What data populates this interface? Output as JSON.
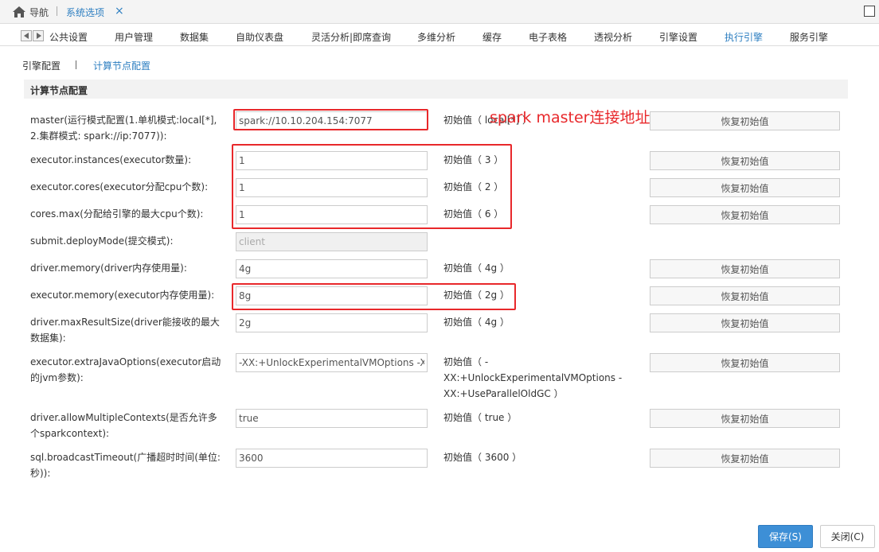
{
  "topbar": {
    "home_label": "导航",
    "active_tab": "系统选项",
    "close_glyph": "×"
  },
  "category_tabs": [
    {
      "label": "公共设置"
    },
    {
      "label": "用户管理"
    },
    {
      "label": "数据集"
    },
    {
      "label": "自助仪表盘"
    },
    {
      "label": "灵活分析|即席查询"
    },
    {
      "label": "多维分析"
    },
    {
      "label": "缓存"
    },
    {
      "label": "电子表格"
    },
    {
      "label": "透视分析"
    },
    {
      "label": "引擎设置"
    },
    {
      "label": "执行引擎",
      "active": true
    },
    {
      "label": "服务引擎"
    }
  ],
  "sub_tabs": {
    "engine_config": "引擎配置",
    "separator": "|",
    "compute_node_config": "计算节点配置"
  },
  "section_title": "计算节点配置",
  "restore_label": "恢复初始值",
  "rows": [
    {
      "label": "master(运行模式配置(1.单机模式:local[*], 2.集群模式: spark://ip:7077)):",
      "value": "spark://10.10.204.154:7077",
      "initial": "初始值（ local[*] ）",
      "disabled": false
    },
    {
      "label": "executor.instances(executor数量):",
      "value": "1",
      "initial": "初始值（ 3 ）",
      "disabled": false
    },
    {
      "label": "executor.cores(executor分配cpu个数):",
      "value": "1",
      "initial": "初始值（ 2 ）",
      "disabled": false
    },
    {
      "label": "cores.max(分配给引擎的最大cpu个数):",
      "value": "1",
      "initial": "初始值（ 6 ）",
      "disabled": false
    },
    {
      "label": "submit.deployMode(提交模式):",
      "value": "client",
      "initial": "",
      "disabled": true
    },
    {
      "label": "driver.memory(driver内存使用量):",
      "value": "4g",
      "initial": "初始值（ 4g ）",
      "disabled": false
    },
    {
      "label": "executor.memory(executor内存使用量):",
      "value": "8g",
      "initial": "初始值（ 2g ）",
      "disabled": false
    },
    {
      "label": "driver.maxResultSize(driver能接收的最大数据集):",
      "value": "2g",
      "initial": "初始值（ 4g ）",
      "disabled": false
    },
    {
      "label": "executor.extraJavaOptions(executor启动的jvm参数):",
      "value": "-XX:+UnlockExperimentalVMOptions -XX:+UseParallelOldGC",
      "initial": "初始值（ -XX:+UnlockExperimentalVMOptions -XX:+UseParallelOldGC ）",
      "disabled": false
    },
    {
      "label": "driver.allowMultipleContexts(是否允许多个sparkcontext):",
      "value": "true",
      "initial": "初始值（ true ）",
      "disabled": false
    },
    {
      "label": "sql.broadcastTimeout(广播超时时间(单位:秒)):",
      "value": "3600",
      "initial": "初始值（ 3600 ）",
      "disabled": false
    }
  ],
  "annotation": "spark master连接地址",
  "footer": {
    "save": "保存(S)",
    "close": "关闭(C)"
  },
  "colors": {
    "accent": "#2e7fc1",
    "annotation_red": "#e8282b",
    "save_button": "#3d8fd6"
  }
}
